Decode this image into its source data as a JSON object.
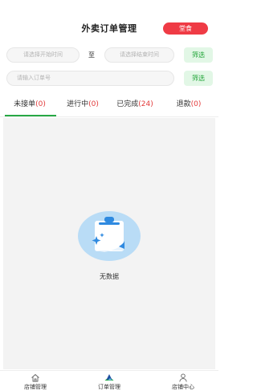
{
  "header": {
    "title": "外卖订单管理",
    "status_label": "堂食"
  },
  "filters": {
    "start_placeholder": "请选择开始时间",
    "to_label": "至",
    "end_placeholder": "请选择结束时间",
    "filter_label_1": "筛选",
    "order_placeholder": "请输入订单号",
    "filter_label_2": "筛选"
  },
  "tabs": [
    {
      "label": "未接单",
      "count": "(0)"
    },
    {
      "label": "进行中",
      "count": "(0)"
    },
    {
      "label": "已完成",
      "count": "(24)"
    },
    {
      "label": "退款",
      "count": "(0)"
    }
  ],
  "empty": {
    "text": "无数据"
  },
  "bottom_nav": [
    {
      "label": "店铺管理",
      "icon": "home-icon"
    },
    {
      "label": "订单管理",
      "icon": "orders-icon"
    },
    {
      "label": "店铺中心",
      "icon": "user-icon"
    }
  ],
  "colors": {
    "accent_green": "#27a844",
    "status_red": "#ef3b45",
    "count_red": "#e23a3a"
  }
}
